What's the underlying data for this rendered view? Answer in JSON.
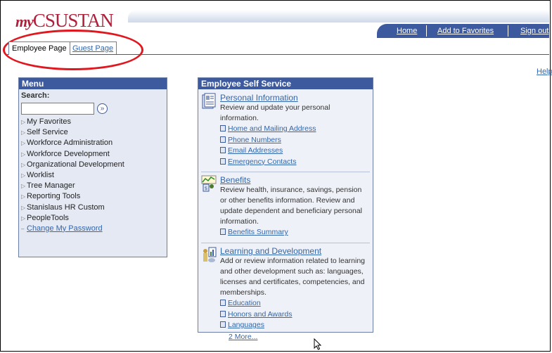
{
  "header": {
    "logo_prefix": "my",
    "logo_text": "CSUSTAN",
    "nav": [
      "Home",
      "Add to Favorites",
      "Sign out"
    ],
    "help": "Help"
  },
  "tabs": [
    {
      "label": "Employee Page",
      "active": true
    },
    {
      "label": "Guest Page",
      "active": false
    }
  ],
  "colors": {
    "accent": "#3d5a9e",
    "link": "#3366aa",
    "highlight_oval": "#e0171e",
    "logo": "#b0203a"
  },
  "menu": {
    "title": "Menu",
    "search_label": "Search:",
    "search_value": "",
    "items": [
      "My Favorites",
      "Self Service",
      "Workforce Administration",
      "Workforce Development",
      "Organizational Development",
      "Worklist",
      "Tree Manager",
      "Reporting Tools",
      "Stanislaus HR Custom",
      "PeopleTools"
    ],
    "change_password": "Change My Password"
  },
  "ess": {
    "title": "Employee Self Service",
    "sections": [
      {
        "title": "Personal Information",
        "icon": "personal-info-icon",
        "description": "Review and update your personal information.",
        "links": [
          "Home and Mailing Address",
          "Phone Numbers",
          "Email Addresses",
          "Emergency Contacts"
        ]
      },
      {
        "title": "Benefits",
        "icon": "benefits-icon",
        "description": "Review health, insurance, savings, pension or other benefits information. Review and update dependent and beneficiary personal information.",
        "links": [
          "Benefits Summary"
        ]
      },
      {
        "title": "Learning and Development",
        "icon": "learning-icon",
        "description": "Add or review information related to learning and other development such as: languages, licenses and certificates, competencies, and memberships.",
        "links": [
          "Education",
          "Honors and Awards",
          "Languages"
        ],
        "more": "2 More..."
      }
    ]
  }
}
